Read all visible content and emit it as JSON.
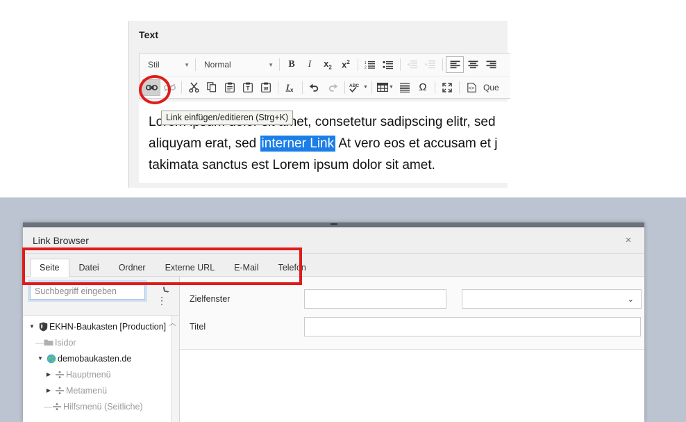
{
  "editor": {
    "section_label": "Text",
    "toolbar_row1": [
      {
        "name": "style-dropdown",
        "label": "Stil",
        "type": "select"
      },
      {
        "name": "format-dropdown",
        "label": "Normal",
        "type": "select"
      },
      {
        "name": "bold-button",
        "label": "B",
        "type": "button"
      },
      {
        "name": "italic-button",
        "label": "I",
        "type": "button"
      },
      {
        "name": "subscript-button",
        "label": "x₂",
        "type": "button"
      },
      {
        "name": "superscript-button",
        "label": "x²",
        "type": "button"
      },
      {
        "name": "numbered-list-button",
        "label": "",
        "type": "button"
      },
      {
        "name": "bulleted-list-button",
        "label": "",
        "type": "button"
      },
      {
        "name": "decrease-indent-button",
        "label": "",
        "type": "button"
      },
      {
        "name": "increase-indent-button",
        "label": "",
        "type": "button"
      },
      {
        "name": "align-left-button",
        "label": "",
        "type": "button"
      },
      {
        "name": "align-center-button",
        "label": "",
        "type": "button"
      },
      {
        "name": "align-right-button",
        "label": "",
        "type": "button"
      }
    ],
    "toolbar_row2": [
      {
        "name": "insert-link-button",
        "label": "",
        "type": "button"
      },
      {
        "name": "unlink-button",
        "label": "",
        "type": "button"
      },
      {
        "name": "cut-button",
        "label": "",
        "type": "button"
      },
      {
        "name": "copy-button",
        "label": "",
        "type": "button"
      },
      {
        "name": "paste-button",
        "label": "",
        "type": "button"
      },
      {
        "name": "paste-as-text-button",
        "label": "",
        "type": "button"
      },
      {
        "name": "paste-from-word-button",
        "label": "",
        "type": "button"
      },
      {
        "name": "remove-format-button",
        "label": "",
        "type": "button"
      },
      {
        "name": "undo-button",
        "label": "",
        "type": "button"
      },
      {
        "name": "redo-button",
        "label": "",
        "type": "button"
      },
      {
        "name": "spellcheck-button",
        "label": "ABC",
        "type": "button"
      },
      {
        "name": "table-button",
        "label": "",
        "type": "button"
      },
      {
        "name": "horizontal-rule-button",
        "label": "",
        "type": "button"
      },
      {
        "name": "special-char-button",
        "label": "Ω",
        "type": "button"
      },
      {
        "name": "maximize-button",
        "label": "",
        "type": "button"
      },
      {
        "name": "source-button",
        "label": "Que",
        "type": "button"
      }
    ],
    "tooltip": "Link einfügen/editieren (Strg+K)",
    "content": {
      "line1_before": "Lorem ipsum dolor sit amet, consetetur sadipscing elitr, sed",
      "line2_before": "aliquyam erat, sed ",
      "line2_selection": "interner Link",
      "line2_after": " At vero eos et accusam et j",
      "line3": "takimata sanctus est Lorem ipsum dolor sit amet."
    },
    "selection_color": "#1a7ee8"
  },
  "dialog": {
    "title": "Link Browser",
    "close_label": "×",
    "tabs": [
      {
        "label": "Seite",
        "active": true
      },
      {
        "label": "Datei",
        "active": false
      },
      {
        "label": "Ordner",
        "active": false
      },
      {
        "label": "Externe URL",
        "active": false
      },
      {
        "label": "E-Mail",
        "active": false
      },
      {
        "label": "Telefon",
        "active": false
      }
    ],
    "tree": {
      "search_placeholder": "Suchbegriff eingeben",
      "search_value": "",
      "items": [
        {
          "label": "EKHN-Baukasten [Production]",
          "indent": 1,
          "twisty": "▼",
          "icon": "shield-icon",
          "dim": false
        },
        {
          "label": "Isidor",
          "indent": 2,
          "twisty": "",
          "icon": "folder-icon",
          "dim": true
        },
        {
          "label": "demobaukasten.de",
          "indent": 2,
          "twisty": "▼",
          "icon": "globe-icon",
          "dim": false
        },
        {
          "label": "Hauptmenü",
          "indent": 3,
          "twisty": "▶",
          "icon": "divider-icon",
          "dim": true
        },
        {
          "label": "Metamenü",
          "indent": 3,
          "twisty": "▶",
          "icon": "divider-icon",
          "dim": true
        },
        {
          "label": "Hilfsmenü (Seitliche)",
          "indent": 3,
          "twisty": "",
          "icon": "divider-icon",
          "dim": true
        }
      ]
    },
    "form": {
      "target_label": "Zielfenster",
      "target_value": "",
      "target_select_value": "",
      "title_label": "Titel",
      "title_value": ""
    }
  },
  "annotations": {
    "ellipse_color": "#e01b1b",
    "rect_color": "#e01b1b"
  }
}
